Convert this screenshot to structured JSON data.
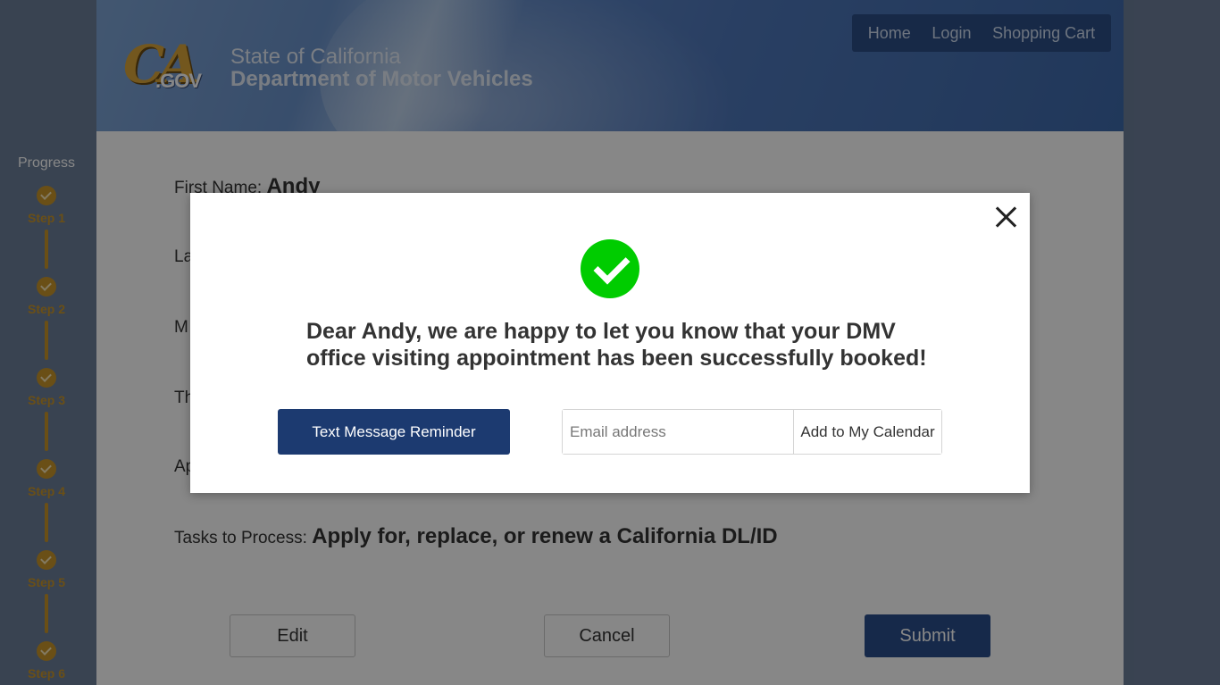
{
  "header": {
    "logo_ca": "CA",
    "logo_gov": ".GOV",
    "agency_line1": "State of California",
    "agency_line2": "Department of Motor Vehicles",
    "nav": [
      "Home",
      "Login",
      "Shopping Cart"
    ]
  },
  "progress": {
    "title": "Progress",
    "steps": [
      "Step 1",
      "Step 2",
      "Step 3",
      "Step 4",
      "Step 5",
      "Step 6"
    ]
  },
  "form": {
    "first_name_label": "First Name:",
    "first_name_value": "Andy",
    "last_name_label": "La",
    "field3_label": "M",
    "field4_label": "Th",
    "field5_label": "Ap",
    "tasks_label": "Tasks to Process:",
    "tasks_value": "Apply for, replace, or renew a California DL/ID",
    "edit_label": "Edit",
    "cancel_label": "Cancel",
    "submit_label": "Submit"
  },
  "modal": {
    "message_line1": "Dear Andy, we are happy to let you know that your DMV",
    "message_line2": "office visiting appointment has been successfully booked!",
    "sms_button": "Text Message Reminder",
    "email_placeholder": "Email address",
    "calendar_button": "Add to My Calendar"
  },
  "colors": {
    "success": "#00cc00",
    "primary_button": "#1c3a70",
    "progress_gold": "#c9962a"
  }
}
